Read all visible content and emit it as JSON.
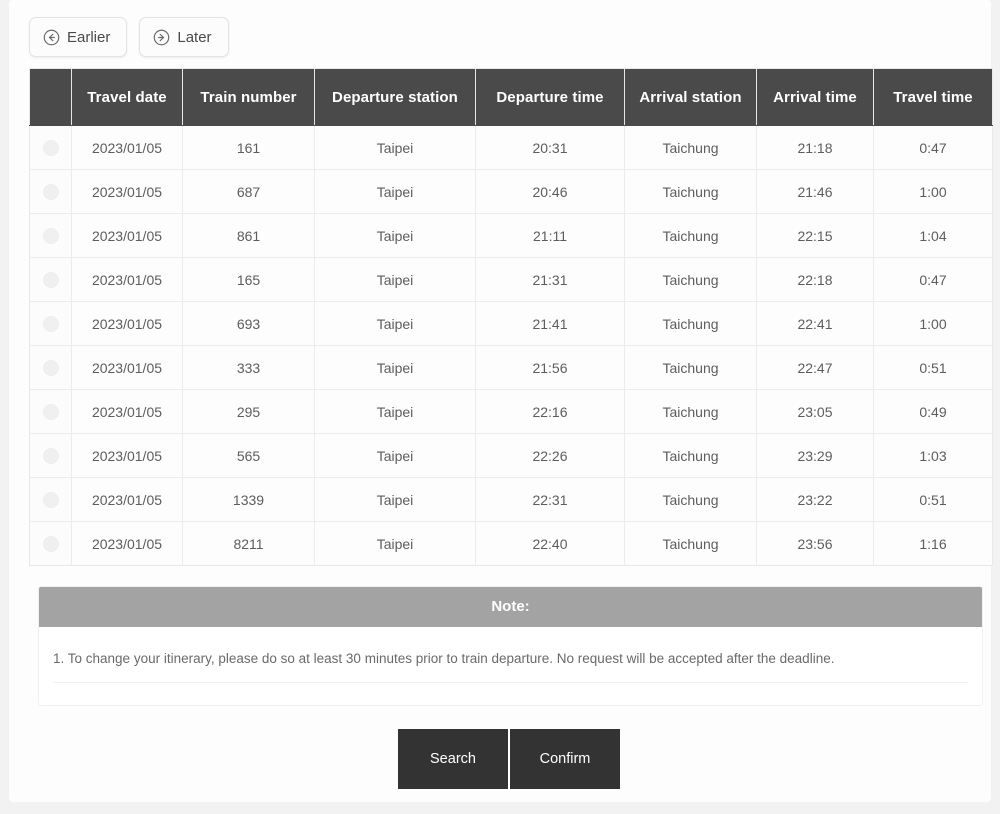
{
  "nav": {
    "buttons": [
      {
        "label": "Earlier",
        "icon": "arrow-circle-left-icon"
      },
      {
        "label": "Later",
        "icon": "arrow-circle-right-icon"
      }
    ]
  },
  "table": {
    "columns": [
      "",
      "Travel date",
      "Train number",
      "Departure station",
      "Departure time",
      "Arrival station",
      "Arrival time",
      "Travel time"
    ],
    "rows": [
      {
        "travel_date": "2023/01/05",
        "train_number": "161",
        "departure_station": "Taipei",
        "departure_time": "20:31",
        "arrival_station": "Taichung",
        "arrival_time": "21:18",
        "travel_time": "0:47"
      },
      {
        "travel_date": "2023/01/05",
        "train_number": "687",
        "departure_station": "Taipei",
        "departure_time": "20:46",
        "arrival_station": "Taichung",
        "arrival_time": "21:46",
        "travel_time": "1:00"
      },
      {
        "travel_date": "2023/01/05",
        "train_number": "861",
        "departure_station": "Taipei",
        "departure_time": "21:11",
        "arrival_station": "Taichung",
        "arrival_time": "22:15",
        "travel_time": "1:04"
      },
      {
        "travel_date": "2023/01/05",
        "train_number": "165",
        "departure_station": "Taipei",
        "departure_time": "21:31",
        "arrival_station": "Taichung",
        "arrival_time": "22:18",
        "travel_time": "0:47"
      },
      {
        "travel_date": "2023/01/05",
        "train_number": "693",
        "departure_station": "Taipei",
        "departure_time": "21:41",
        "arrival_station": "Taichung",
        "arrival_time": "22:41",
        "travel_time": "1:00"
      },
      {
        "travel_date": "2023/01/05",
        "train_number": "333",
        "departure_station": "Taipei",
        "departure_time": "21:56",
        "arrival_station": "Taichung",
        "arrival_time": "22:47",
        "travel_time": "0:51"
      },
      {
        "travel_date": "2023/01/05",
        "train_number": "295",
        "departure_station": "Taipei",
        "departure_time": "22:16",
        "arrival_station": "Taichung",
        "arrival_time": "23:05",
        "travel_time": "0:49"
      },
      {
        "travel_date": "2023/01/05",
        "train_number": "565",
        "departure_station": "Taipei",
        "departure_time": "22:26",
        "arrival_station": "Taichung",
        "arrival_time": "23:29",
        "travel_time": "1:03"
      },
      {
        "travel_date": "2023/01/05",
        "train_number": "1339",
        "departure_station": "Taipei",
        "departure_time": "22:31",
        "arrival_station": "Taichung",
        "arrival_time": "23:22",
        "travel_time": "0:51"
      },
      {
        "travel_date": "2023/01/05",
        "train_number": "8211",
        "departure_station": "Taipei",
        "departure_time": "22:40",
        "arrival_station": "Taichung",
        "arrival_time": "23:56",
        "travel_time": "1:16"
      }
    ]
  },
  "note": {
    "title": "Note:",
    "items": [
      "1. To change your itinerary, please do so at least 30 minutes prior to train departure. No request will be accepted after the deadline."
    ]
  },
  "actions": {
    "search_label": "Search",
    "confirm_label": "Confirm"
  },
  "colors": {
    "page_background": "#f2f2f2",
    "card_background": "#fdfdfd",
    "table_header": "#4a4a4a",
    "note_header": "#a3a3a3",
    "action_button": "#333333",
    "text_primary": "#5d5d5d"
  }
}
